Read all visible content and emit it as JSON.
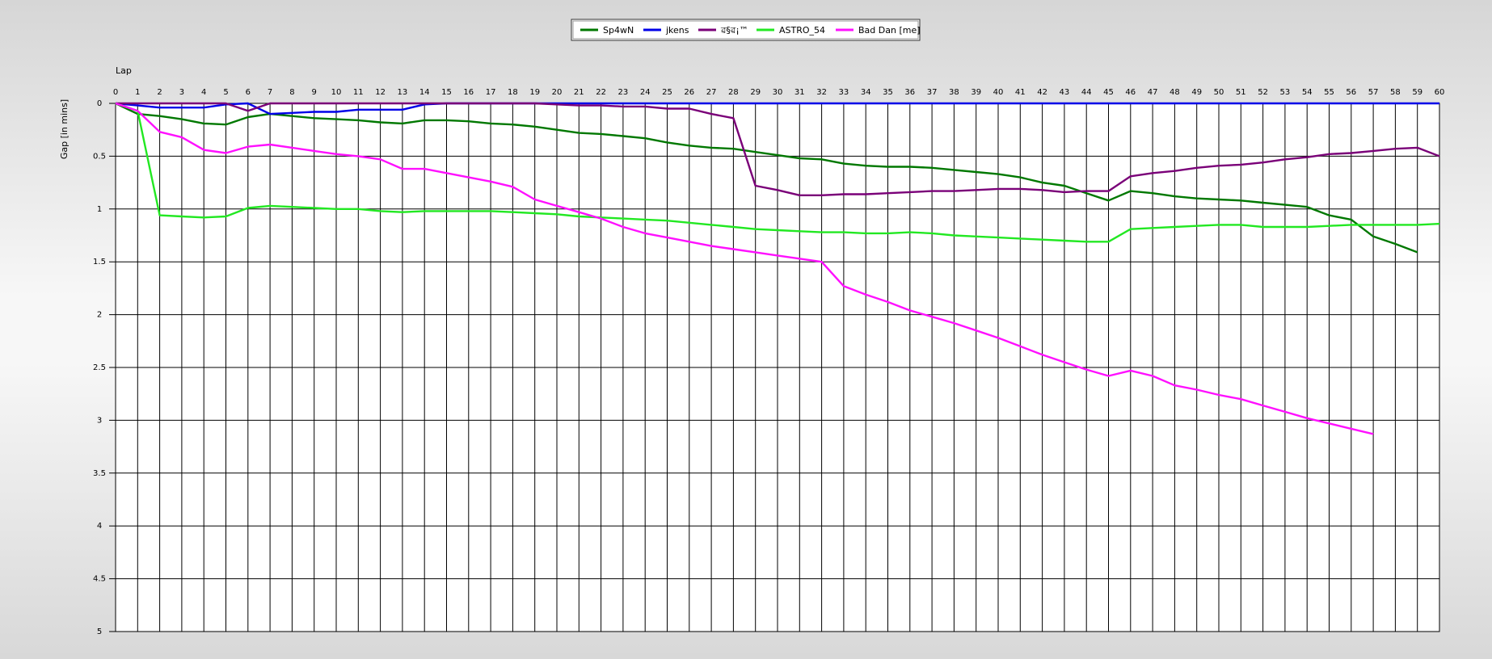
{
  "chart_data": {
    "type": "line",
    "xlabel": "Lap",
    "ylabel": "Gap [in mins]",
    "xlim": [
      0,
      60
    ],
    "ylim": [
      0,
      5
    ],
    "y_inverted": true,
    "grid": true,
    "legend_position": "top-center",
    "x": [
      0,
      1,
      2,
      3,
      4,
      5,
      6,
      7,
      8,
      9,
      10,
      11,
      12,
      13,
      14,
      15,
      16,
      17,
      18,
      19,
      20,
      21,
      22,
      23,
      24,
      25,
      26,
      27,
      28,
      29,
      30,
      31,
      32,
      33,
      34,
      35,
      36,
      37,
      38,
      39,
      40,
      41,
      42,
      43,
      44,
      45,
      46,
      47,
      48,
      49,
      50,
      51,
      52,
      53,
      54,
      55,
      56,
      57,
      58,
      59,
      60
    ],
    "xticks": [
      "0",
      "1",
      "2",
      "3",
      "4",
      "5",
      "6",
      "7",
      "8",
      "9",
      "10",
      "11",
      "12",
      "13",
      "14",
      "15",
      "16",
      "17",
      "18",
      "19",
      "20",
      "21",
      "22",
      "23",
      "24",
      "25",
      "26",
      "27",
      "28",
      "29",
      "30",
      "31",
      "32",
      "33",
      "34",
      "35",
      "36",
      "37",
      "38",
      "39",
      "40",
      "41",
      "42",
      "43",
      "44",
      "45",
      "46",
      "47",
      "48",
      "49",
      "50",
      "51",
      "52",
      "53",
      "54",
      "55",
      "56",
      "57",
      "58",
      "59",
      "60"
    ],
    "yticks": [
      "0",
      "0.5",
      "1",
      "1.5",
      "2",
      "2.5",
      "3",
      "3.5",
      "4",
      "4.5",
      "5"
    ],
    "series": [
      {
        "name": "Sp4wN",
        "color": "#007800",
        "values": [
          0,
          0.1,
          0.12,
          0.15,
          0.19,
          0.2,
          0.13,
          0.1,
          0.12,
          0.14,
          0.15,
          0.16,
          0.18,
          0.19,
          0.16,
          0.16,
          0.17,
          0.19,
          0.2,
          0.22,
          0.25,
          0.28,
          0.29,
          0.31,
          0.33,
          0.37,
          0.4,
          0.42,
          0.43,
          0.46,
          0.49,
          0.52,
          0.53,
          0.57,
          0.59,
          0.6,
          0.6,
          0.61,
          0.63,
          0.65,
          0.67,
          0.7,
          0.75,
          0.78,
          0.85,
          0.92,
          0.83,
          0.85,
          0.88,
          0.9,
          0.91,
          0.92,
          0.94,
          0.96,
          0.98,
          1.06,
          1.1,
          1.26,
          1.33,
          1.41
        ]
      },
      {
        "name": "jkens",
        "color": "#0000e8",
        "values": [
          0,
          0.02,
          0.04,
          0.04,
          0.04,
          0.01,
          0,
          0.1,
          0.09,
          0.08,
          0.08,
          0.06,
          0.06,
          0.06,
          0.01,
          0,
          0,
          0,
          0,
          0,
          0,
          0,
          0,
          0,
          0,
          0,
          0,
          0,
          0,
          0,
          0,
          0,
          0,
          0,
          0,
          0,
          0,
          0,
          0,
          0,
          0,
          0,
          0,
          0,
          0,
          0,
          0,
          0,
          0,
          0,
          0,
          0,
          0,
          0,
          0,
          0,
          0,
          0,
          0,
          0,
          0
        ]
      },
      {
        "name": "ৱ§ৱ¡™",
        "color": "#7a0078",
        "values": [
          0,
          0,
          0,
          0,
          0,
          0,
          0.07,
          0,
          0,
          0,
          0,
          0,
          0,
          0,
          0,
          0,
          0,
          0,
          0,
          0,
          0.01,
          0.02,
          0.02,
          0.03,
          0.03,
          0.05,
          0.05,
          0.1,
          0.14,
          0.78,
          0.82,
          0.87,
          0.87,
          0.86,
          0.86,
          0.85,
          0.84,
          0.83,
          0.83,
          0.82,
          0.81,
          0.81,
          0.82,
          0.84,
          0.83,
          0.83,
          0.69,
          0.66,
          0.64,
          0.61,
          0.59,
          0.58,
          0.56,
          0.53,
          0.51,
          0.48,
          0.47,
          0.45,
          0.43,
          0.42,
          0.5
        ]
      },
      {
        "name": "ASTRO_54",
        "color": "#22e822",
        "values": [
          0,
          0.07,
          1.06,
          1.07,
          1.08,
          1.07,
          0.99,
          0.97,
          0.98,
          0.99,
          1.0,
          1.0,
          1.02,
          1.03,
          1.02,
          1.02,
          1.02,
          1.02,
          1.03,
          1.04,
          1.05,
          1.07,
          1.08,
          1.09,
          1.1,
          1.11,
          1.13,
          1.15,
          1.17,
          1.19,
          1.2,
          1.21,
          1.22,
          1.22,
          1.23,
          1.23,
          1.22,
          1.23,
          1.25,
          1.26,
          1.27,
          1.28,
          1.29,
          1.3,
          1.31,
          1.31,
          1.19,
          1.18,
          1.17,
          1.16,
          1.15,
          1.15,
          1.17,
          1.17,
          1.17,
          1.16,
          1.15,
          1.15,
          1.15,
          1.15,
          1.14
        ]
      },
      {
        "name": "Bad Dan [me]",
        "color": "#ff10ff",
        "values": [
          0,
          0.07,
          0.27,
          0.32,
          0.44,
          0.47,
          0.41,
          0.39,
          0.42,
          0.45,
          0.48,
          0.5,
          0.53,
          0.62,
          0.62,
          0.66,
          0.7,
          0.74,
          0.79,
          0.91,
          0.97,
          1.03,
          1.09,
          1.17,
          1.23,
          1.27,
          1.31,
          1.35,
          1.38,
          1.41,
          1.44,
          1.47,
          1.5,
          1.73,
          1.81,
          1.88,
          1.96,
          2.02,
          2.08,
          2.15,
          2.22,
          2.3,
          2.38,
          2.45,
          2.52,
          2.58,
          2.53,
          2.58,
          2.67,
          2.71,
          2.76,
          2.8,
          2.86,
          2.92,
          2.98,
          3.03,
          3.08,
          3.13
        ]
      }
    ]
  }
}
